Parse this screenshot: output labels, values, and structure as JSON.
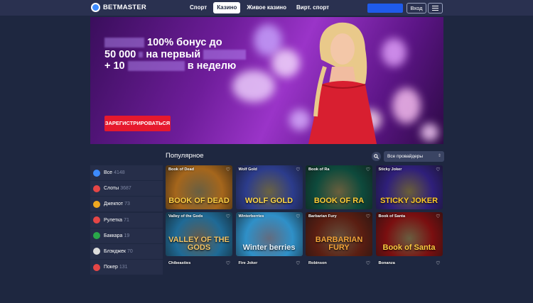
{
  "header": {
    "logo": "BETMASTER",
    "nav": [
      "Спорт",
      "Казино",
      "Живое казино",
      "Вирт. спорт"
    ],
    "login": "Вход"
  },
  "banner": {
    "line1": "100% бонус до",
    "line2a": "50 000",
    "line2b": "на первый",
    "line3a": "+ 10",
    "line3b": "в неделю",
    "register": "ЗАРЕГИСТРИРОВАТЬСЯ"
  },
  "section": {
    "title": "Популярное",
    "providers": "Все провайдеры"
  },
  "sidebar": [
    {
      "label": "Все",
      "count": "4148",
      "color": "#3d8bff"
    },
    {
      "label": "Слоты",
      "count": "3687",
      "color": "#e64646"
    },
    {
      "label": "Джекпот",
      "count": "73",
      "color": "#f0a820"
    },
    {
      "label": "Рулетка",
      "count": "71",
      "color": "#e64646"
    },
    {
      "label": "Баккара",
      "count": "19",
      "color": "#2aa84a"
    },
    {
      "label": "Блэкджек",
      "count": "70",
      "color": "#dddddd"
    },
    {
      "label": "Покер",
      "count": "131",
      "color": "#e64646"
    }
  ],
  "games": [
    {
      "title": "Book of Dead",
      "word": "BOOK OF DEAD",
      "bg": "#a5661c",
      "fg": "#ffcf45"
    },
    {
      "title": "Wolf Gold",
      "word": "WOLF GOLD",
      "bg": "#2c3c8c",
      "fg": "#ffd84a"
    },
    {
      "title": "Book of Ra",
      "word": "BOOK OF RA",
      "bg": "#0e4a3c",
      "fg": "#ffce38"
    },
    {
      "title": "Sticky Joker",
      "word": "STICKY JOKER",
      "bg": "#2f1f7a",
      "fg": "#ffcb2b"
    },
    {
      "title": "Valley of the Gods",
      "word": "VALLEY OF THE GODS",
      "bg": "#1f6a96",
      "fg": "#f3c466"
    },
    {
      "title": "Winterberries",
      "word": "Winter berries",
      "bg": "#2f90c8",
      "fg": "#e9f6ff"
    },
    {
      "title": "Barbarian Fury",
      "word": "BARBARIAN FURY",
      "bg": "#5a1e12",
      "fg": "#f5a53a"
    },
    {
      "title": "Book of Santa",
      "word": "Book of Santa",
      "bg": "#7a0f10",
      "fg": "#ffcb40"
    },
    {
      "title": "Chibeasties",
      "word": "",
      "bg": "#3a6a2a",
      "fg": "#fff"
    },
    {
      "title": "Fire Joker",
      "word": "",
      "bg": "#6a1a1a",
      "fg": "#fff"
    },
    {
      "title": "Robinson",
      "word": "",
      "bg": "#2a4a6a",
      "fg": "#fff"
    },
    {
      "title": "Bonanza",
      "word": "",
      "bg": "#4a2a6a",
      "fg": "#fff"
    }
  ]
}
